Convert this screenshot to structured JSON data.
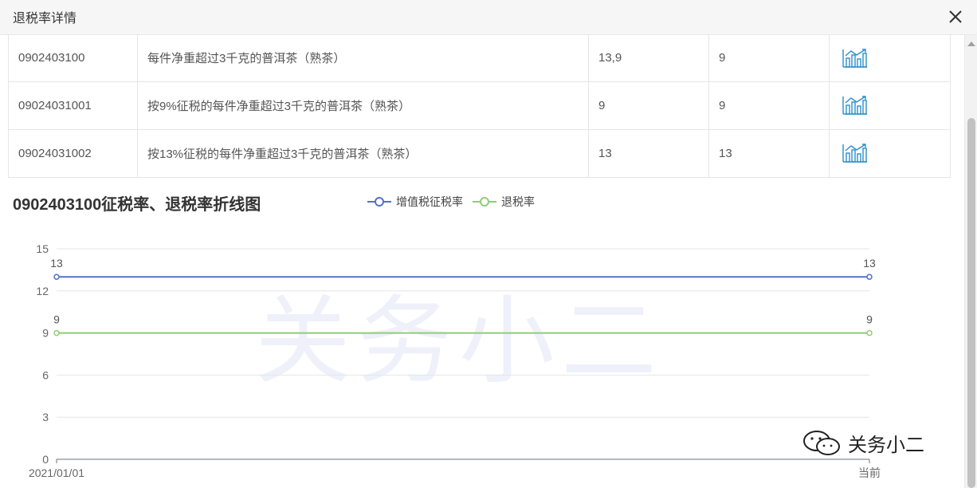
{
  "dialog": {
    "title": "退税率详情"
  },
  "table": {
    "rows": [
      {
        "code": "0902403100",
        "name": "每件净重超过3千克的普洱茶（熟茶）",
        "vat_rate": "13,9",
        "refund_rate": "9"
      },
      {
        "code": "09024031001",
        "name": "按9%征税的每件净重超过3千克的普洱茶（熟茶）",
        "vat_rate": "9",
        "refund_rate": "9"
      },
      {
        "code": "09024031002",
        "name": "按13%征税的每件净重超过3千克的普洱茶（熟茶）",
        "vat_rate": "13",
        "refund_rate": "13"
      }
    ]
  },
  "chart_data": {
    "type": "line",
    "title": "0902403100征税率、退税率折线图",
    "categories": [
      "2021/01/01",
      "当前"
    ],
    "series": [
      {
        "name": "增值税征税率",
        "values": [
          13,
          13
        ],
        "color": "#5470c6"
      },
      {
        "name": "退税率",
        "values": [
          9,
          9
        ],
        "color": "#91cc75"
      }
    ],
    "ylim": [
      0,
      15
    ],
    "yticks": [
      0,
      3,
      6,
      9,
      12,
      15
    ],
    "grid": true,
    "legend": "top"
  },
  "watermark": {
    "text": "关务小二"
  },
  "logo": {
    "text": "关务小二"
  },
  "icons": {
    "close": "close-icon",
    "chart": "line-chart-icon",
    "logo": "wechat-icon"
  }
}
